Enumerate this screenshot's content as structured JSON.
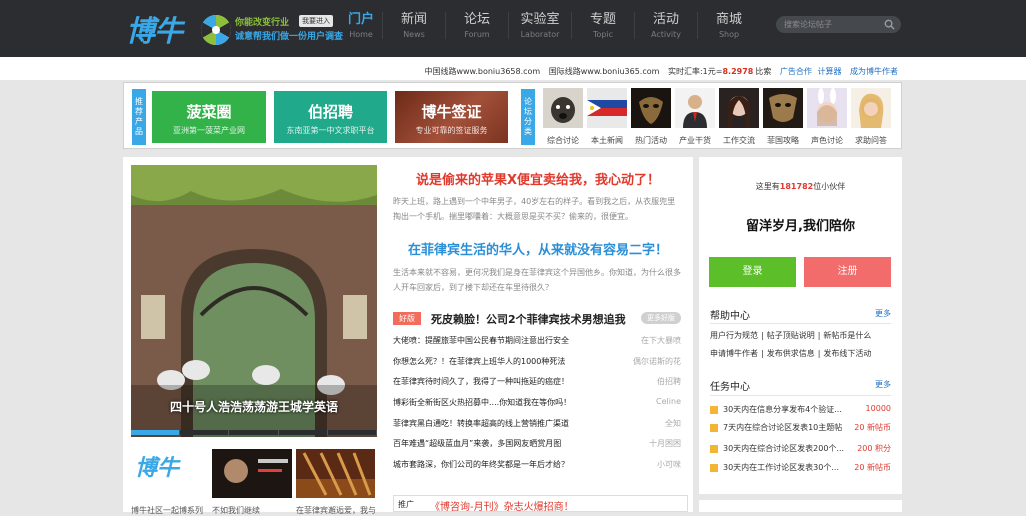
{
  "header": {
    "logo": "博牛",
    "promo_line1": "你能改变行业",
    "promo_badge": "我要进入",
    "promo_line2": "诚意帮我们做一份用户调查",
    "nav": [
      {
        "cn": "门户",
        "en": "Home",
        "active": true
      },
      {
        "cn": "新闻",
        "en": "News"
      },
      {
        "cn": "论坛",
        "en": "Forum"
      },
      {
        "cn": "实验室",
        "en": "Laborator"
      },
      {
        "cn": "专题",
        "en": "Topic"
      },
      {
        "cn": "活动",
        "en": "Activity"
      },
      {
        "cn": "商城",
        "en": "Shop"
      }
    ],
    "search_placeholder": "搜索论坛帖子"
  },
  "infobar": {
    "line_cn": "中国线路www.boniu3658.com",
    "line_intl": "国际线路www.boniu365.com",
    "rate_label": "实时汇率:1元=",
    "rate_value": "8.2978",
    "rate_unit": "比索",
    "ad": "广告合作",
    "calc": "计算器",
    "author": "成为博牛作者"
  },
  "categories": {
    "recommend_label": "推荐产品",
    "forum_label": "论坛分类",
    "tiles": [
      {
        "title": "菠菜圈",
        "sub": "亚洲第一菠菜产业网",
        "color": "#33b24a"
      },
      {
        "title": "伯招聘",
        "sub": "东南亚第一中文求职平台",
        "color": "#20a98a"
      },
      {
        "title": "博牛签证",
        "sub": "专业可靠的签证服务",
        "color": "#8c3b22"
      }
    ],
    "items": [
      {
        "label": "综合讨论",
        "icon": "dog-photo-icon"
      },
      {
        "label": "本土新闻",
        "icon": "philippines-flag-icon"
      },
      {
        "label": "热门活动",
        "icon": "mask-photo-icon"
      },
      {
        "label": "产业干货",
        "icon": "business-man-icon"
      },
      {
        "label": "工作交流",
        "icon": "woman-photo-icon"
      },
      {
        "label": "菲国攻略",
        "icon": "map-mask-icon"
      },
      {
        "label": "声色讨论",
        "icon": "rabbit-girl-icon"
      },
      {
        "label": "求助问答",
        "icon": "question-girl-icon"
      }
    ]
  },
  "main": {
    "photo_caption": "四十号人浩浩荡荡游王城学英语",
    "mini_logo": "博牛",
    "ad_captions": [
      "博牛社区一起博系列",
      "不如我们继续",
      "在菲律宾邂逅爱，我与"
    ],
    "headline1": "说是偷来的苹果X便宜卖给我，我心动了！",
    "para1": "昨天上班，路上遇到一个中年男子，40岁左右的样子。看到我之后，从衣服兜里掏出一个手机。揣里嘟囔着：大概意思是买不买？偷来的，很便宜。",
    "headline2": "在菲律宾生活的华人，从来就没有容易二字！",
    "para2": "生活本来就不容易，更何况我们是身在菲律宾这个异国他乡。你知道，为什么很多人开车回家后，到了楼下却还在车里待很久？",
    "news_tag": "好版",
    "news_title": "死皮赖脸！公司2个菲律宾技术男想追我",
    "news_more": "更多好版",
    "news": [
      {
        "t": "大佬喷：提醒旅菲中国公民春节期间注意出行安全",
        "a": "在下大暴喷"
      },
      {
        "t": "你想怎么死？！在菲律宾上班华人的1000种死法",
        "a": "偶尔诺斯的花"
      },
      {
        "t": "在菲律宾待时间久了，我得了一种叫拖延的癌症！",
        "a": "伯招聘"
      },
      {
        "t": "博彩街全新街区火热招募中....你知道我在等你吗！",
        "a": "Celine"
      },
      {
        "t": "菲律宾黑白通吃！转换率超高的线上营销推广渠道",
        "a": "全知"
      },
      {
        "t": "百年难遇“超级蓝血月”来袭，多国网友晒赏月图",
        "a": "十月困困"
      },
      {
        "t": "城市套路深，你们公司的年终奖都是一年后才给？",
        "a": "小可咪"
      }
    ],
    "adbar_label": "推广",
    "adbar_text": "《博咨询-月刊》杂志火爆招商！"
  },
  "sidebar": {
    "count_prefix": "这里有",
    "count_value": "181782",
    "count_suffix": "位小伙伴",
    "slogan": "留洋岁月,我们陪你",
    "login": "登录",
    "register": "注册",
    "help_title": "帮助中心",
    "more": "更多",
    "help_line1": [
      "用户行为规范",
      "|",
      "帖子顶贴说明",
      "|",
      "新帖币是什么"
    ],
    "help_line2": [
      "申请博牛作者",
      "|",
      "发布供求信息",
      "|",
      "发布线下活动"
    ],
    "task_title": "任务中心",
    "tasks": [
      {
        "t": "30天内在信息分享发布4个验证...",
        "r": "10000"
      },
      {
        "t": "7天内在综合讨论区发表10主题帖",
        "r": "20 新帖币"
      },
      {
        "t": "30天内在综合讨论区发表200个...",
        "r": "200 积分"
      },
      {
        "t": "30天内在工作讨论区发表30个...",
        "r": "20 新帖币"
      }
    ]
  },
  "colors": {
    "accent": "#3aa7e6",
    "login": "#5cbf2a",
    "register": "#f26c6c",
    "topbar": "#2b2d30"
  }
}
